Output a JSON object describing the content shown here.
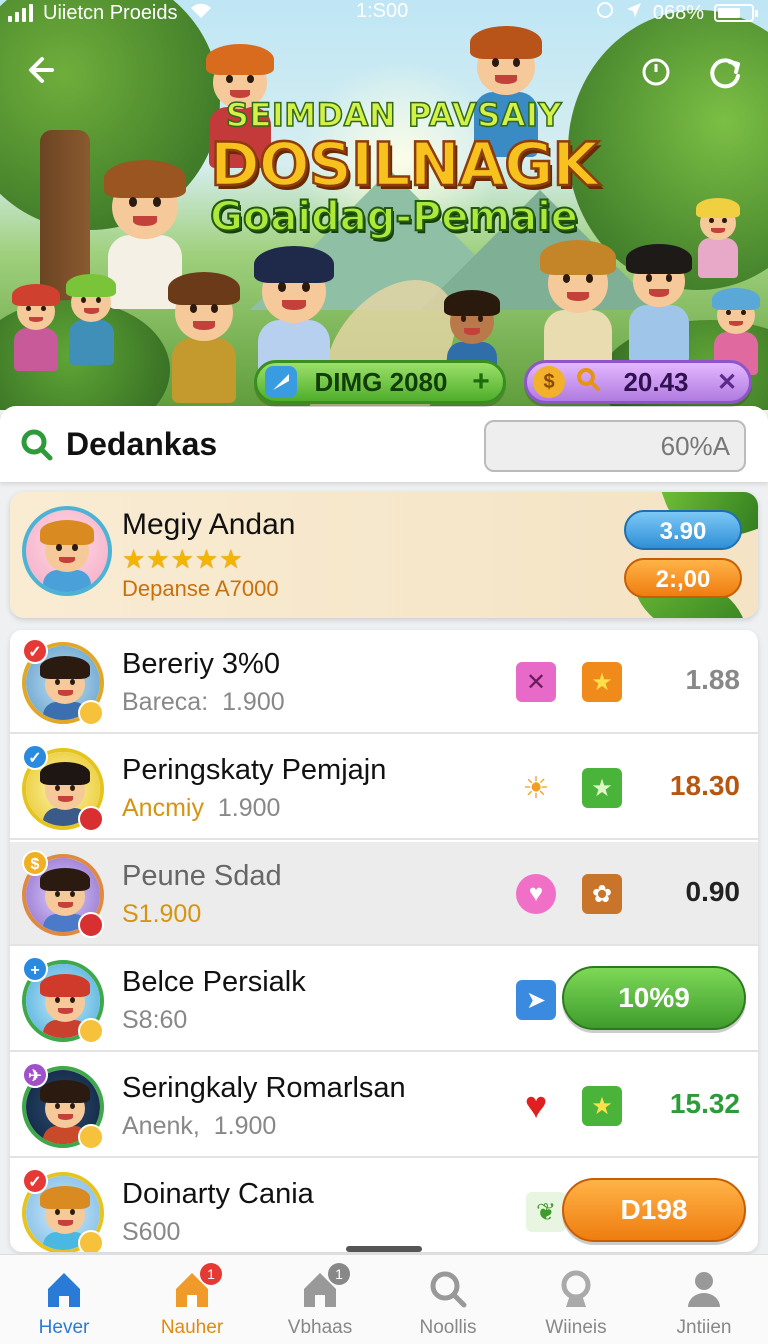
{
  "status_bar": {
    "carrier": "Uiietcn Proeids",
    "time": "1:S00",
    "battery": "068%",
    "battery_level": 0.68
  },
  "hero": {
    "title_line1": "SEIMDAN PAVSAIY",
    "title_line2": "DOSILNAGK",
    "title_line3": "Goaidag-Pemaie",
    "pill_left": {
      "label": "DIMG 2080",
      "icon": "check-icon",
      "action_icon": "plus-icon"
    },
    "pill_right": {
      "label": "20.43",
      "icon": "coin-icon",
      "action_icon": "close-icon"
    }
  },
  "search": {
    "title": "Dedankas",
    "field_value": "60%A"
  },
  "featured": {
    "name": "Megiy Andan",
    "rating": 5,
    "rating_stars": "★★★★★",
    "subtitle": "Depanse A7000",
    "button_top": "3.90",
    "button_bottom": "2:,00"
  },
  "list": [
    {
      "title": "Bereriy 3%0",
      "meta_label": "Bareca:",
      "meta_value": "1.900",
      "icon1": "close-box-icon",
      "icon2": "star-box-icon",
      "value": "1.88",
      "value_color": "#888888"
    },
    {
      "title": "Peringskaty Pemjajn",
      "meta_label": "Ancmiy",
      "meta_value": "1.900",
      "icon1": "bird-icon",
      "icon2": "star-box-icon",
      "value": "18.30",
      "value_color": "#b8560f"
    },
    {
      "title": "Peune Sdad",
      "meta_label": "",
      "meta_value": "S1.900",
      "icon1": "heart-circle-icon",
      "icon2": "gear-box-icon",
      "value": "0.90",
      "value_color": "#222222"
    },
    {
      "title": "Belce Persialk",
      "meta_label": "",
      "meta_value": "S8:60",
      "icon1": "paper-plane-icon",
      "icon2": "",
      "button": "10%9",
      "button_color": "green"
    },
    {
      "title": "Seringkaly Romarlsan",
      "meta_label": "Anenk,",
      "meta_value": "1.900",
      "icon1": "heart-icon",
      "icon2": "star-box-icon",
      "value": "15.32",
      "value_color": "#2e9b3a"
    },
    {
      "title": "Doinarty Cania",
      "meta_label": "",
      "meta_value": "S600",
      "icon1": "leaf-icon",
      "icon2": "",
      "button": "D198",
      "button_color": "orange"
    }
  ],
  "nav": [
    {
      "label": "Hever",
      "icon": "home-icon",
      "active": true
    },
    {
      "label": "Nauher",
      "icon": "house-badge-icon",
      "badge": "1"
    },
    {
      "label": "Vbhaas",
      "icon": "building-icon",
      "badge": "1"
    },
    {
      "label": "Noollis",
      "icon": "search-icon"
    },
    {
      "label": "Wiineis",
      "icon": "trophy-icon"
    },
    {
      "label": "Jntiien",
      "icon": "user-icon"
    }
  ]
}
